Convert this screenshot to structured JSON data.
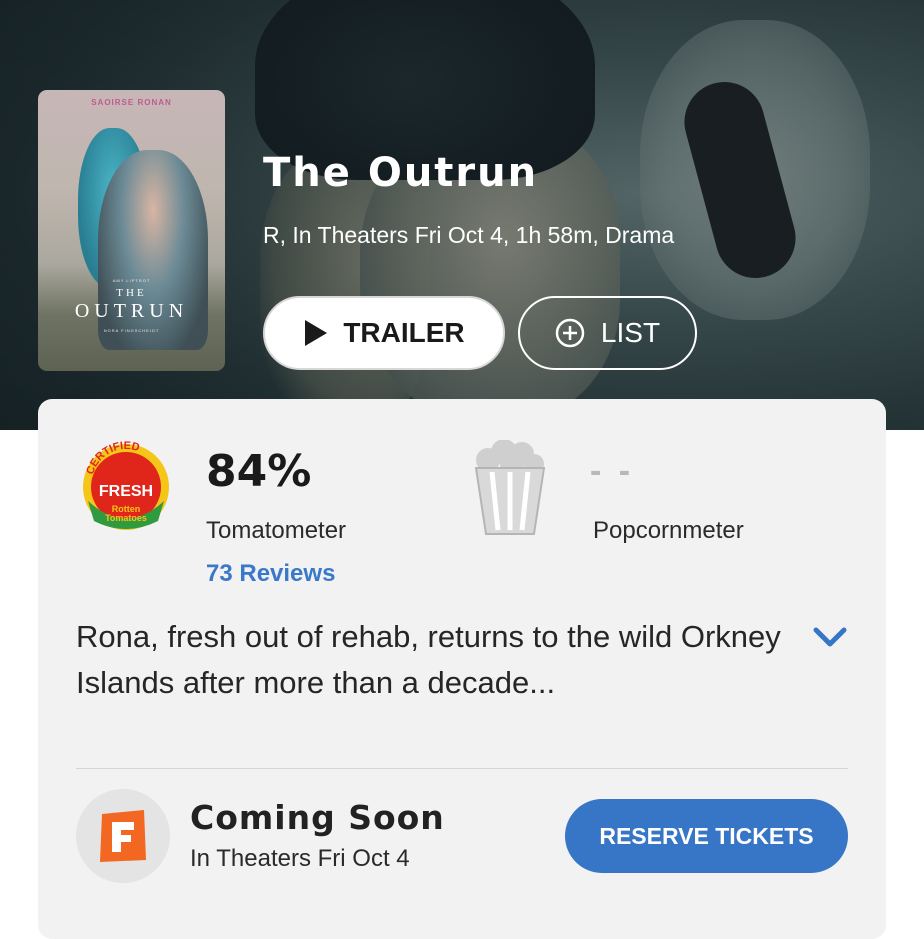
{
  "movie": {
    "title": "The Outrun",
    "meta": "R, In Theaters Fri Oct 4, 1h 58m, Drama",
    "poster": {
      "actor": "SAOIRSE RONAN",
      "title_the": "THE",
      "title_main": "OUTRUN",
      "author": "AMY LIPTROT",
      "director": "NORA FINGSCHEIDT"
    }
  },
  "actions": {
    "trailer_label": "TRAILER",
    "list_label": "LIST"
  },
  "scores": {
    "tomatometer": {
      "value": "84%",
      "label": "Tomatometer",
      "reviews": "73 Reviews",
      "badge": {
        "top": "CERTIFIED",
        "middle": "FRESH",
        "bottom1": "Rotten",
        "bottom2": "Tomatoes"
      }
    },
    "popcornmeter": {
      "value": "- -",
      "label": "Popcornmeter"
    }
  },
  "synopsis": "Rona, fresh out of rehab, returns to the wild Orkney Islands after more than a decade...",
  "tickets": {
    "status": "Coming Soon",
    "date": "In Theaters Fri Oct 4",
    "button_label": "RESERVE TICKETS"
  },
  "colors": {
    "accent_blue": "#3775c6",
    "link_blue": "#3a78c9",
    "card_bg": "#f2f2f2"
  }
}
